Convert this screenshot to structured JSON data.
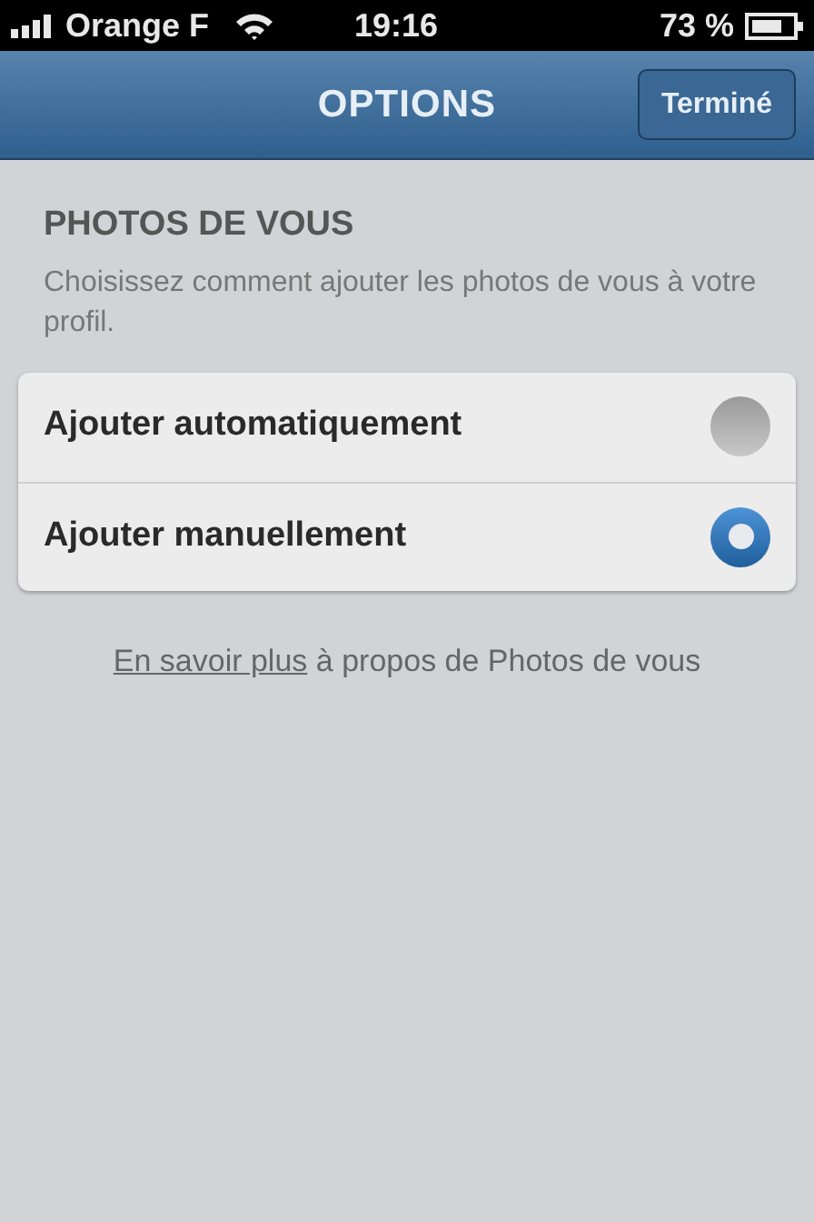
{
  "status_bar": {
    "carrier": "Orange F",
    "time": "19:16",
    "battery": "73 %"
  },
  "nav_bar": {
    "title": "OPTIONS",
    "done_button": "Terminé"
  },
  "section": {
    "title": "PHOTOS DE VOUS",
    "description": "Choisissez comment ajouter les photos de vous à votre profil."
  },
  "options": [
    {
      "label": "Ajouter automatiquement",
      "selected": false
    },
    {
      "label": "Ajouter manuellement",
      "selected": true
    }
  ],
  "footer": {
    "link": "En savoir plus",
    "text": "à propos de Photos de vous"
  }
}
